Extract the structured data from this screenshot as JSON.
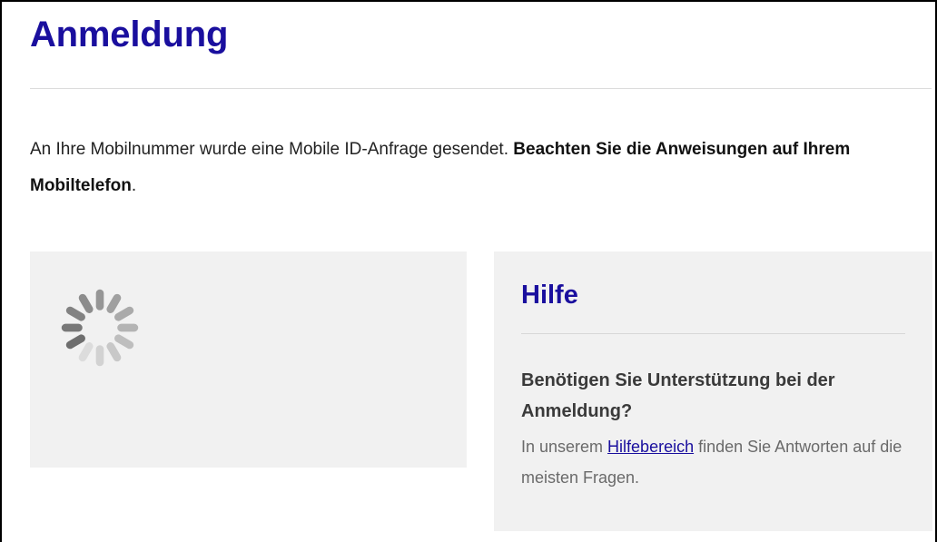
{
  "page": {
    "title": "Anmeldung"
  },
  "intro": {
    "text": "An Ihre Mobilnummer wurde eine Mobile ID-Anfrage gesendet. ",
    "bold_text": "Beachten Sie die Anweisungen auf Ihrem Mobiltelefon",
    "end": "."
  },
  "loading": {
    "icon": "spinner-icon"
  },
  "help": {
    "title": "Hilfe",
    "question": "Benötigen Sie Unterstützung bei der Anmeldung?",
    "text_before": "In unserem ",
    "link_label": "Hilfebereich",
    "text_after": " finden Sie Antworten auf die meisten Fragen."
  },
  "colors": {
    "brand": "#1a0f9e",
    "panel_bg": "#f1f1f1",
    "text": "#222222"
  }
}
